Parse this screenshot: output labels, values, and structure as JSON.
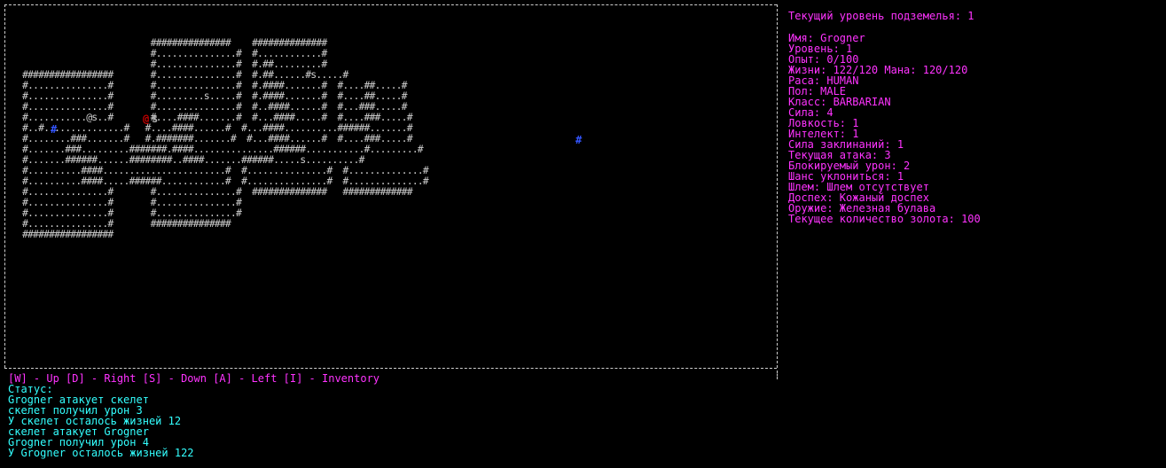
{
  "map": {
    "rows": [
      "                        ###############    ##############",
      "                        #...............#  #............#",
      "                        #...............#  #.##.........#",
      "#################       #...............#  #.##......#s.....#",
      "#...............#       #...............#  #.####.......#  #....##.....#",
      "#...............#       #.........s.....#  #.####.......#  #....##.....#",
      "#...............#       #...............#  #..####......#  #...###.....#",
      "#...........@s..#       #....####.......#  #...####.....#  #....###.....#",
      "#..#...............#   #....####......#  #...####..........######.......#",
      "#........###.......#   #.#######.......#  #...####......#  #....###.....#",
      "#.......###.........#######.####...............######...........#.........#",
      "#.......######......########..####.......######.....s..........#",
      "#..........####.......................#  #...............#  #..............#",
      "#..........####.....######............#  #...............#  #..............#",
      "#...............#       #...............#  ##############   #############",
      "#...............#       #...............#",
      "#...............#       #...............#",
      "#...............#       ###############",
      "#################"
    ]
  },
  "tokens": {
    "player": {
      "glyph": "@",
      "color": "#cc0000"
    },
    "enemy_s": {
      "glyph": "s",
      "color": "#b0b0b0"
    },
    "marker_blue": {
      "glyph": "#",
      "color": "#3355ff"
    }
  },
  "info": {
    "dungeon_level": "Текущий уровень подземелья: 1",
    "name": "Имя: Grogner",
    "level": "Уровень: 1",
    "experience": "Опыт: 0/100",
    "life_mana": "Жизни: 122/120 Мана: 120/120",
    "race": "Раса: HUMAN",
    "gender": "Пол: MALE",
    "class": "Класс: BARBARIAN",
    "strength": "Сила: 4",
    "agility": "Ловкость: 1",
    "intellect": "Интелект: 1",
    "spell_power": "Сила заклинаний: 1",
    "attack": "Текущая атака: 3",
    "blocked_damage": "Блокируемый урон: 2",
    "dodge": "Шанс уклониться: 1",
    "helmet": "Шлем: Шлем отсутствует",
    "armor": "Доспех: Кожаный доспех",
    "weapon": "Оружие: Железная булава",
    "gold": "Текущее количество золота: 100"
  },
  "controls": "[W] - Up [D] - Right [S] - Down [A] - Left [I] - Inventory",
  "status": {
    "title": "Статус:",
    "lines": [
      "Grogner атакует скелет",
      "скелет получил урон 3",
      "У скелет осталось жизней 12",
      "скелет атакует Grogner",
      "Grogner получил урон 4",
      "У Grogner осталось жизней 122"
    ]
  }
}
